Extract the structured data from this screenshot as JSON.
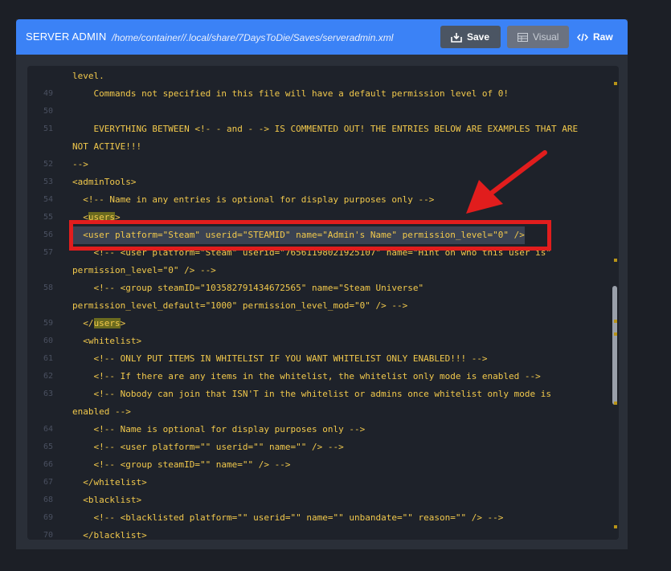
{
  "header": {
    "title": "SERVER ADMIN",
    "path": "/home/container//.local/share/7DaysToDie/Saves/serveradmin.xml",
    "buttons": {
      "save": "Save",
      "visual": "Visual",
      "raw": "Raw"
    },
    "color": "#3b82f6"
  },
  "editor": {
    "lines": [
      {
        "num": "",
        "text": "level."
      },
      {
        "num": "49",
        "text": "    Commands not specified in this file will have a default permission level of 0!"
      },
      {
        "num": "50",
        "text": ""
      },
      {
        "num": "51",
        "text": "    EVERYTHING BETWEEN <!- - and - -> IS COMMENTED OUT! THE ENTRIES BELOW ARE EXAMPLES THAT ARE"
      },
      {
        "num": "",
        "text": "NOT ACTIVE!!!"
      },
      {
        "num": "52",
        "text": "-->"
      },
      {
        "num": "53",
        "text": "<adminTools>"
      },
      {
        "num": "54",
        "text": "  <!-- Name in any entries is optional for display purposes only -->"
      },
      {
        "num": "55",
        "pre": "  <",
        "hl": "users",
        "post": ">"
      },
      {
        "num": "56",
        "text": "  <user platform=\"Steam\" userid=\"STEAMID\" name=\"Admin's Name\" permission_level=\"0\" />",
        "selected": true
      },
      {
        "num": "57",
        "text": "    <!-- <user platform=\"Steam\" userid=\"76561198021925107\" name=\"Hint on who this user is\""
      },
      {
        "num": "",
        "text": "permission_level=\"0\" /> -->"
      },
      {
        "num": "58",
        "text": "    <!-- <group steamID=\"103582791434672565\" name=\"Steam Universe\""
      },
      {
        "num": "",
        "text": "permission_level_default=\"1000\" permission_level_mod=\"0\" /> -->"
      },
      {
        "num": "59",
        "pre": "  </",
        "hl": "users",
        "post": ">"
      },
      {
        "num": "60",
        "text": "  <whitelist>"
      },
      {
        "num": "61",
        "text": "    <!-- ONLY PUT ITEMS IN WHITELIST IF YOU WANT WHITELIST ONLY ENABLED!!! -->"
      },
      {
        "num": "62",
        "text": "    <!-- If there are any items in the whitelist, the whitelist only mode is enabled -->"
      },
      {
        "num": "63",
        "text": "    <!-- Nobody can join that ISN'T in the whitelist or admins once whitelist only mode is"
      },
      {
        "num": "",
        "text": "enabled -->"
      },
      {
        "num": "64",
        "text": "    <!-- Name is optional for display purposes only -->"
      },
      {
        "num": "65",
        "text": "    <!-- <user platform=\"\" userid=\"\" name=\"\" /> -->"
      },
      {
        "num": "66",
        "text": "    <!-- <group steamID=\"\" name=\"\" /> -->"
      },
      {
        "num": "67",
        "text": "  </whitelist>"
      },
      {
        "num": "68",
        "text": "  <blacklist>"
      },
      {
        "num": "69",
        "text": "    <!-- <blacklisted platform=\"\" userid=\"\" name=\"\" unbandate=\"\" reason=\"\" /> -->"
      },
      {
        "num": "70",
        "text": "  </blacklist>"
      }
    ],
    "text_color": "#f2c94c",
    "highlight_color": "#6b6b1f"
  },
  "annotations": {
    "box_color": "#e11d1d",
    "arrow_color": "#e11d1d"
  }
}
